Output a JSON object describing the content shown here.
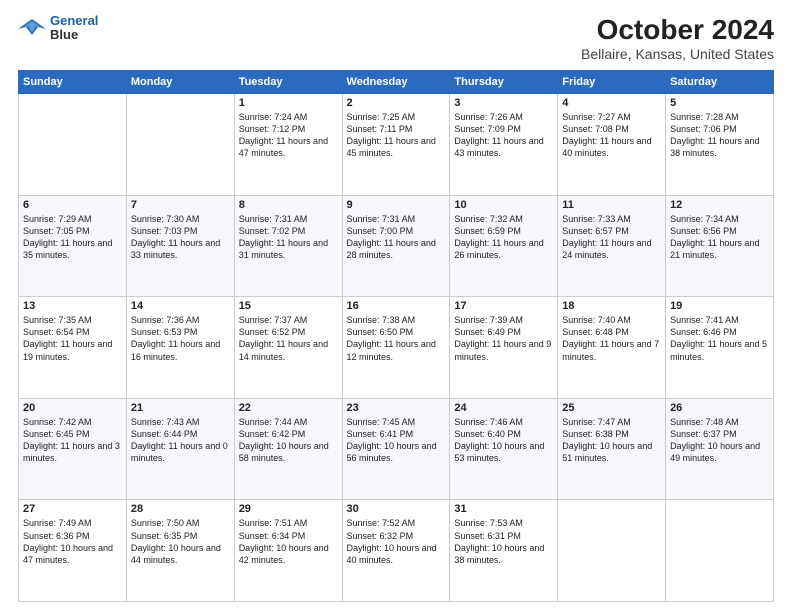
{
  "logo": {
    "line1": "General",
    "line2": "Blue"
  },
  "title": "October 2024",
  "subtitle": "Bellaire, Kansas, United States",
  "weekdays": [
    "Sunday",
    "Monday",
    "Tuesday",
    "Wednesday",
    "Thursday",
    "Friday",
    "Saturday"
  ],
  "weeks": [
    [
      null,
      null,
      {
        "day": 1,
        "sunrise": "7:24 AM",
        "sunset": "7:12 PM",
        "daylight": "11 hours and 47 minutes."
      },
      {
        "day": 2,
        "sunrise": "7:25 AM",
        "sunset": "7:11 PM",
        "daylight": "11 hours and 45 minutes."
      },
      {
        "day": 3,
        "sunrise": "7:26 AM",
        "sunset": "7:09 PM",
        "daylight": "11 hours and 43 minutes."
      },
      {
        "day": 4,
        "sunrise": "7:27 AM",
        "sunset": "7:08 PM",
        "daylight": "11 hours and 40 minutes."
      },
      {
        "day": 5,
        "sunrise": "7:28 AM",
        "sunset": "7:06 PM",
        "daylight": "11 hours and 38 minutes."
      }
    ],
    [
      {
        "day": 6,
        "sunrise": "7:29 AM",
        "sunset": "7:05 PM",
        "daylight": "11 hours and 35 minutes."
      },
      {
        "day": 7,
        "sunrise": "7:30 AM",
        "sunset": "7:03 PM",
        "daylight": "11 hours and 33 minutes."
      },
      {
        "day": 8,
        "sunrise": "7:31 AM",
        "sunset": "7:02 PM",
        "daylight": "11 hours and 31 minutes."
      },
      {
        "day": 9,
        "sunrise": "7:31 AM",
        "sunset": "7:00 PM",
        "daylight": "11 hours and 28 minutes."
      },
      {
        "day": 10,
        "sunrise": "7:32 AM",
        "sunset": "6:59 PM",
        "daylight": "11 hours and 26 minutes."
      },
      {
        "day": 11,
        "sunrise": "7:33 AM",
        "sunset": "6:57 PM",
        "daylight": "11 hours and 24 minutes."
      },
      {
        "day": 12,
        "sunrise": "7:34 AM",
        "sunset": "6:56 PM",
        "daylight": "11 hours and 21 minutes."
      }
    ],
    [
      {
        "day": 13,
        "sunrise": "7:35 AM",
        "sunset": "6:54 PM",
        "daylight": "11 hours and 19 minutes."
      },
      {
        "day": 14,
        "sunrise": "7:36 AM",
        "sunset": "6:53 PM",
        "daylight": "11 hours and 16 minutes."
      },
      {
        "day": 15,
        "sunrise": "7:37 AM",
        "sunset": "6:52 PM",
        "daylight": "11 hours and 14 minutes."
      },
      {
        "day": 16,
        "sunrise": "7:38 AM",
        "sunset": "6:50 PM",
        "daylight": "11 hours and 12 minutes."
      },
      {
        "day": 17,
        "sunrise": "7:39 AM",
        "sunset": "6:49 PM",
        "daylight": "11 hours and 9 minutes."
      },
      {
        "day": 18,
        "sunrise": "7:40 AM",
        "sunset": "6:48 PM",
        "daylight": "11 hours and 7 minutes."
      },
      {
        "day": 19,
        "sunrise": "7:41 AM",
        "sunset": "6:46 PM",
        "daylight": "11 hours and 5 minutes."
      }
    ],
    [
      {
        "day": 20,
        "sunrise": "7:42 AM",
        "sunset": "6:45 PM",
        "daylight": "11 hours and 3 minutes."
      },
      {
        "day": 21,
        "sunrise": "7:43 AM",
        "sunset": "6:44 PM",
        "daylight": "11 hours and 0 minutes."
      },
      {
        "day": 22,
        "sunrise": "7:44 AM",
        "sunset": "6:42 PM",
        "daylight": "10 hours and 58 minutes."
      },
      {
        "day": 23,
        "sunrise": "7:45 AM",
        "sunset": "6:41 PM",
        "daylight": "10 hours and 56 minutes."
      },
      {
        "day": 24,
        "sunrise": "7:46 AM",
        "sunset": "6:40 PM",
        "daylight": "10 hours and 53 minutes."
      },
      {
        "day": 25,
        "sunrise": "7:47 AM",
        "sunset": "6:38 PM",
        "daylight": "10 hours and 51 minutes."
      },
      {
        "day": 26,
        "sunrise": "7:48 AM",
        "sunset": "6:37 PM",
        "daylight": "10 hours and 49 minutes."
      }
    ],
    [
      {
        "day": 27,
        "sunrise": "7:49 AM",
        "sunset": "6:36 PM",
        "daylight": "10 hours and 47 minutes."
      },
      {
        "day": 28,
        "sunrise": "7:50 AM",
        "sunset": "6:35 PM",
        "daylight": "10 hours and 44 minutes."
      },
      {
        "day": 29,
        "sunrise": "7:51 AM",
        "sunset": "6:34 PM",
        "daylight": "10 hours and 42 minutes."
      },
      {
        "day": 30,
        "sunrise": "7:52 AM",
        "sunset": "6:32 PM",
        "daylight": "10 hours and 40 minutes."
      },
      {
        "day": 31,
        "sunrise": "7:53 AM",
        "sunset": "6:31 PM",
        "daylight": "10 hours and 38 minutes."
      },
      null,
      null
    ]
  ]
}
